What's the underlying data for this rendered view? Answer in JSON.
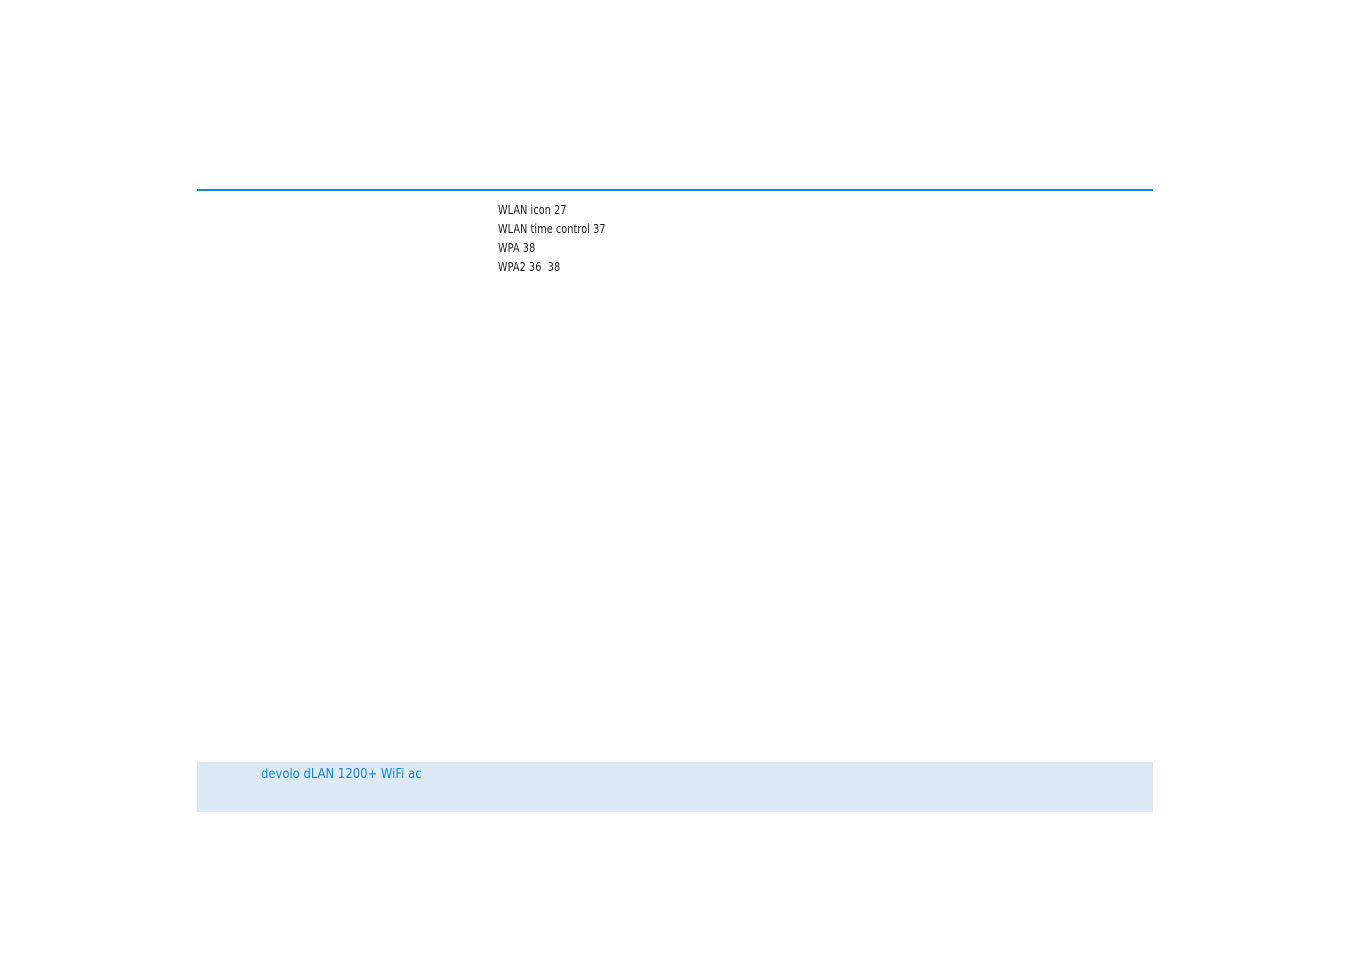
{
  "index": {
    "entries": [
      "WLAN icon 27",
      "WLAN time control 37",
      "WPA 38",
      "WPA2 36  38"
    ]
  },
  "footer": {
    "title": "devolo dLAN 1200+ WiFi ac"
  },
  "colors": {
    "accent": "#1287d7",
    "footer_band": "#dce9f4",
    "text": "#1a1a1a"
  }
}
